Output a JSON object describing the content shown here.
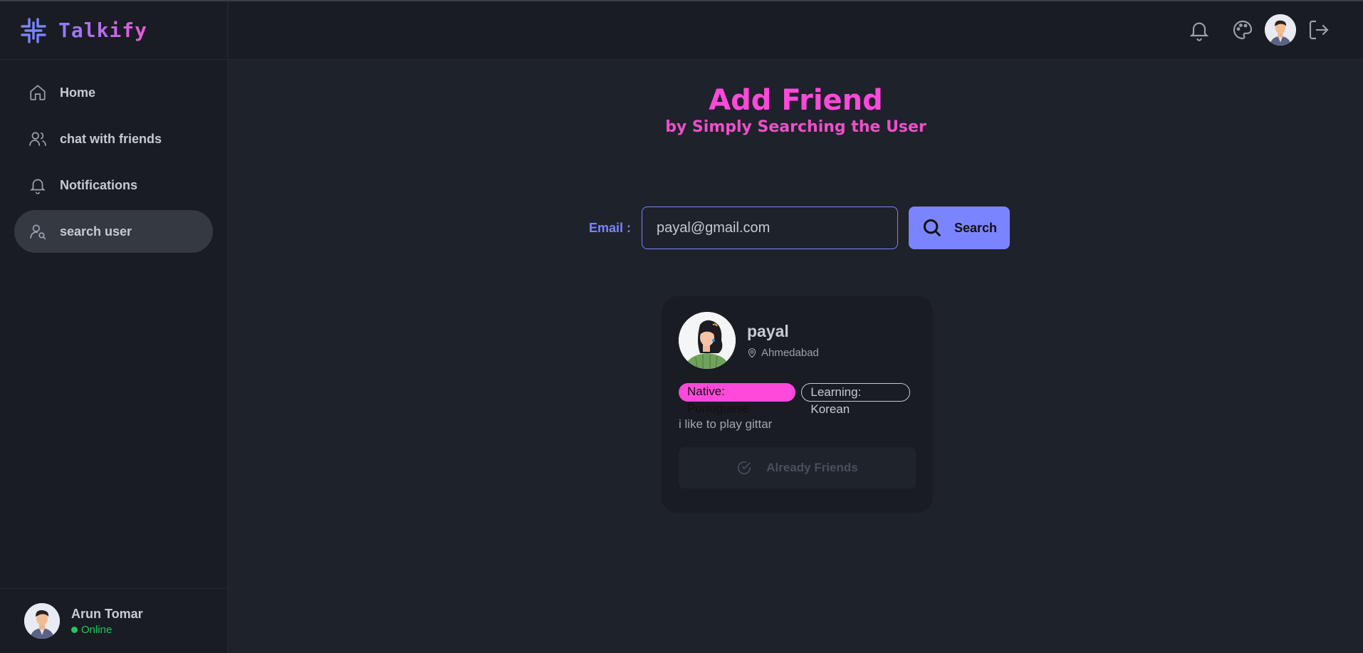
{
  "app": {
    "name": "Talkify",
    "accent_color": "#7b84ff",
    "highlight_color": "#ff49db"
  },
  "sidebar": {
    "items": [
      {
        "label": "Home",
        "icon": "home-icon",
        "active": false
      },
      {
        "label": "chat with friends",
        "icon": "users-icon",
        "active": false
      },
      {
        "label": "Notifications",
        "icon": "bell-icon",
        "active": false
      },
      {
        "label": "search user",
        "icon": "user-search-icon",
        "active": true
      }
    ]
  },
  "current_user": {
    "name": "Arun Tomar",
    "status": "Online"
  },
  "header": {
    "icons": [
      "bell-icon",
      "palette-icon",
      "avatar",
      "logout-icon"
    ]
  },
  "main": {
    "title": "Add Friend",
    "subtitle": "by Simply Searching the User",
    "search": {
      "label": "Email :",
      "value": "payal@gmail.com",
      "button_label": "Search"
    },
    "result": {
      "name": "payal",
      "location": "Ahmedabad",
      "native_tag": "Native: Portuguese",
      "learning_tag": "Learning: Korean",
      "bio": "i like to play gittar",
      "action_label": "Already Friends"
    }
  }
}
